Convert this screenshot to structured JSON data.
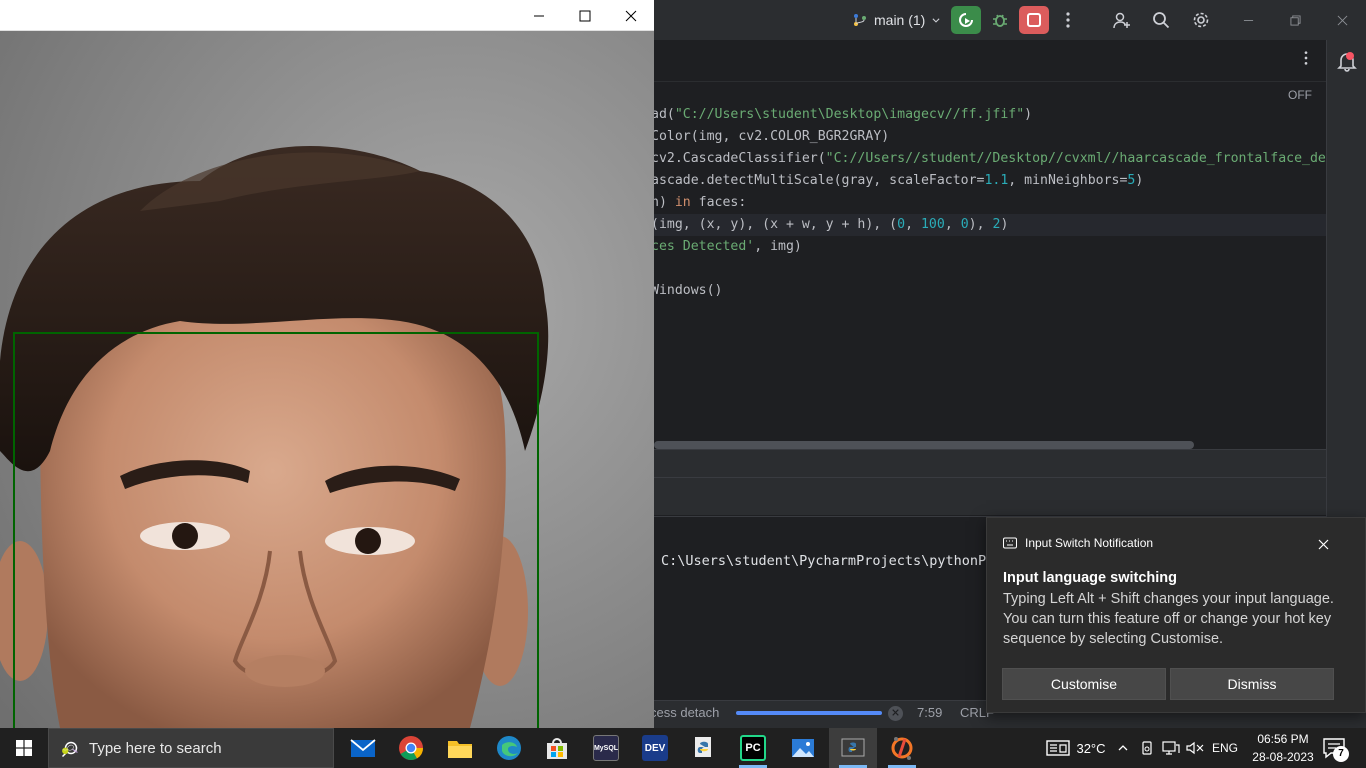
{
  "ide": {
    "branch_label": "main (1)",
    "off_label": "OFF",
    "code_lines": [
      {
        "parts": [
          [
            "plain",
            "ad("
          ],
          [
            "str",
            "\"C://Users\\student\\Desktop\\imagecv//ff.jfif\""
          ],
          [
            "plain",
            ")"
          ]
        ]
      },
      {
        "parts": [
          [
            "plain",
            "Color(img, cv2.COLOR_BGR2GRAY)"
          ]
        ]
      },
      {
        "parts": [
          [
            "plain",
            "cv2.CascadeClassifier("
          ],
          [
            "str",
            "\"C://Users//student//Desktop//cvxml//haarcascade_frontalface_de"
          ]
        ]
      },
      {
        "parts": [
          [
            "plain",
            "ascade.detectMultiScale(gray, scaleFactor="
          ],
          [
            "num",
            "1.1"
          ],
          [
            "plain",
            ", minNeighbors="
          ],
          [
            "num",
            "5"
          ],
          [
            "plain",
            ")"
          ]
        ]
      },
      {
        "parts": [
          [
            "plain",
            "h) "
          ],
          [
            "kw",
            "in"
          ],
          [
            "plain",
            " faces:"
          ]
        ]
      },
      {
        "parts": [
          [
            "plain",
            "(img, (x, y), (x + w, y + h), ("
          ],
          [
            "num",
            "0"
          ],
          [
            "plain",
            ", "
          ],
          [
            "num",
            "100"
          ],
          [
            "plain",
            ", "
          ],
          [
            "num",
            "0"
          ],
          [
            "plain",
            "), "
          ],
          [
            "num",
            "2"
          ],
          [
            "plain",
            ")"
          ]
        ],
        "highlight": true
      },
      {
        "parts": [
          [
            "str",
            "ces Detected'"
          ],
          [
            "plain",
            ", img)"
          ]
        ]
      },
      {
        "parts": [
          [
            "plain",
            ""
          ]
        ]
      },
      {
        "parts": [
          [
            "plain",
            "Windows()"
          ]
        ]
      }
    ],
    "terminal_path": "C:\\Users\\student\\PycharmProjects\\pythonPr",
    "status": {
      "process_text": "cess detach",
      "position": "7:59",
      "line_ending": "CRLF"
    }
  },
  "toast": {
    "app_name": "Input Switch Notification",
    "heading": "Input language switching",
    "body": "Typing Left Alt + Shift changes your input language. You can turn this feature off or change your hot key sequence by selecting Customise.",
    "customise_label": "Customise",
    "dismiss_label": "Dismiss"
  },
  "taskbar": {
    "search_placeholder": "Type here to search",
    "apps": [
      {
        "name": "mail",
        "label": ""
      },
      {
        "name": "chrome",
        "label": ""
      },
      {
        "name": "file-explorer",
        "label": ""
      },
      {
        "name": "edge",
        "label": ""
      },
      {
        "name": "microsoft-store",
        "label": ""
      },
      {
        "name": "myseq",
        "label": "MySQL"
      },
      {
        "name": "devcpp",
        "label": "DEV"
      },
      {
        "name": "python-idle",
        "label": ""
      },
      {
        "name": "pycharm",
        "label": "PC"
      },
      {
        "name": "photos",
        "label": ""
      },
      {
        "name": "python-window",
        "label": ""
      },
      {
        "name": "jupyter",
        "label": ""
      }
    ],
    "weather": "32°C",
    "language": "ENG",
    "time": "06:56 PM",
    "date": "28-08-2023",
    "notification_count": "7"
  },
  "colors": {
    "ide_bg": "#1e1f22",
    "face_box": "#006400",
    "accent": "#3574f0",
    "toast_bg": "#2b2b2b"
  }
}
